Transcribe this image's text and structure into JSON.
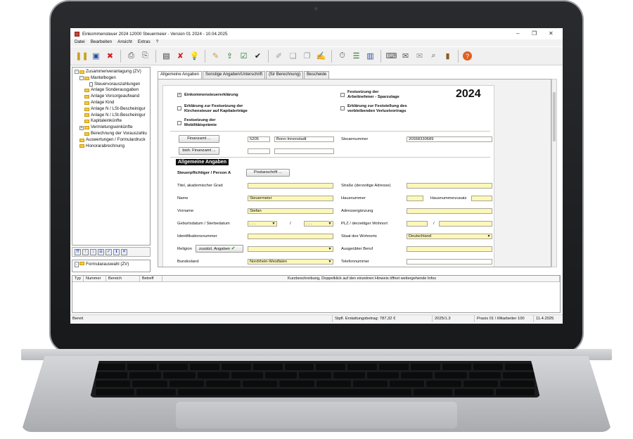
{
  "window": {
    "title": "Einkommensteuer 2024 12000 Steuermeier - Version 01 2024 - 10.04.2025"
  },
  "menu": [
    "Datei",
    "Bearbeiten",
    "Ansicht",
    "Extras",
    "?"
  ],
  "tree": [
    {
      "label": "Zusammenveranlagung (ZV)",
      "level": 0,
      "box": "-",
      "icon": "folder"
    },
    {
      "label": "Mantelbogen",
      "level": 1,
      "box": "-",
      "icon": "folder"
    },
    {
      "label": "Steuervorauszahlungen",
      "level": 2,
      "box": "",
      "icon": "doc"
    },
    {
      "label": "Anlage Sonderausgaben",
      "level": 1,
      "box": "",
      "icon": "folder"
    },
    {
      "label": "Anlage Vorsorgeaufwand",
      "level": 1,
      "box": "",
      "icon": "folder"
    },
    {
      "label": "Anlage Kind",
      "level": 1,
      "box": "",
      "icon": "folder"
    },
    {
      "label": "Anlage N / LSt-Bescheinigur",
      "level": 1,
      "box": "",
      "icon": "folder"
    },
    {
      "label": "Anlage N / LSt-Bescheinigur",
      "level": 1,
      "box": "",
      "icon": "folder"
    },
    {
      "label": "Kapitaleinkünfte",
      "level": 1,
      "box": "",
      "icon": "folder"
    },
    {
      "label": "Vermietungseinkünfte",
      "level": 1,
      "box": "+",
      "icon": "folder"
    },
    {
      "label": "Berechnung der Vorauszahlu",
      "level": 1,
      "box": "",
      "icon": "folder"
    },
    {
      "label": "Auswertungen / Formulardruck",
      "level": 0,
      "box": "",
      "icon": "folder"
    },
    {
      "label": "Honorarabrechnung",
      "level": 0,
      "box": "",
      "icon": "folder"
    }
  ],
  "form_selector": {
    "label": "Formularauswahl (ZV)"
  },
  "tabs": [
    "Allgemeine Angaben",
    "Sonstige Angaben/Unterschrift",
    "(für Berechnung)",
    "Bescheide"
  ],
  "form": {
    "year": "2024",
    "checks": {
      "est": {
        "label": "Einkommensteuererklärung",
        "checked": true
      },
      "kirchensteuer": {
        "line1": "Erklärung zur Festsetzung der",
        "line2": "Kirchensteuer auf Kapitalerträge",
        "checked": false
      },
      "mobilitaet": {
        "line1": "Festsetzung der",
        "line2": "Mobilitätsprämie",
        "checked": false
      },
      "sparzulage": {
        "line1": "Festsetzung der",
        "line2": "Arbeitnehmer - Sparzulage",
        "checked": false
      },
      "verlust": {
        "line1": "Erklärung zur Feststellung des",
        "line2": "verbleibenden Verlustvortrags",
        "checked": false
      }
    },
    "finanzamt_button": "Finanzamt ...",
    "bish_finanzamt_button": "bish. Finanzamt ...",
    "finanzamt_nr": "5205",
    "finanzamt_name": "Bonn-Innenstadt",
    "steuernummer_label": "Steuernummer",
    "steuernummer": "20558330689",
    "section_title": "Allgemeine Angaben",
    "person_title": "Steuerpflichtiger / Person A",
    "postanschrift_button": "Postanschrift ...",
    "labels": {
      "titel": "Titel, akademischer Grad",
      "name": "Name",
      "vorname": "Vorname",
      "geburt": "Geburtsdatum / Sterbedatum",
      "idnr": "Identifikationsnummer",
      "religion": "Religion",
      "bundesland": "Bundesland",
      "strasse": "Straße (derzeitige Adresse)",
      "hausnummer": "Hausnummer",
      "hausnummerzusatz": "Hausnummerzusatz",
      "adresserg": "Adressergänzung",
      "plz": "PLZ / derzeitiger Wohnort",
      "staat": "Staat des Wohnorts",
      "beruf": "Ausgeübter Beruf",
      "telefon": "Telefonnummer"
    },
    "values": {
      "name": "Steuermeier",
      "vorname": "Stefan",
      "geburt_placeholder": ". . .",
      "staat": "Deutschland",
      "bundesland": "Nordrhein-Westfalen",
      "slash": "/"
    },
    "zusaetzl_button": "zusätzl. Angaben"
  },
  "messages": {
    "headers": [
      "Typ",
      "Nummer",
      "Bereich",
      "Betreff",
      "Kurzbeschreibung, Doppelklick auf den einzelnen Hinweis öffnet weitergehende Infos"
    ]
  },
  "status": {
    "ready": "Bereit",
    "erstattung": "Stpfl. Erstattungsbetrag: 787,32  €",
    "version": "2025/1.3",
    "praxis": "Praxis 01 \\ Mitarbeiter 100",
    "date": "11.4.2025"
  }
}
